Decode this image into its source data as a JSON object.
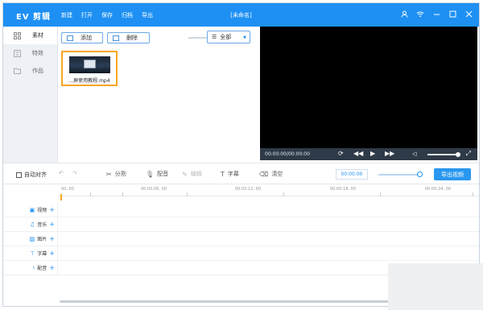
{
  "titlebar": {
    "logo": "EV 剪辑",
    "menu": [
      "新建",
      "打开",
      "保存",
      "归档",
      "导出"
    ],
    "doc_title": "[未命名]"
  },
  "leftnav": {
    "items": [
      {
        "label": "素材",
        "icon": "grid-icon",
        "active": true
      },
      {
        "label": "特效",
        "icon": "effects-icon",
        "active": false
      },
      {
        "label": "作品",
        "icon": "folder-icon",
        "active": false
      }
    ]
  },
  "media": {
    "add_label": "添加",
    "delete_label": "删除",
    "filter_value": "全部",
    "file_name": "...屏使用教程.mp4"
  },
  "preview": {
    "timecode": "00:00:00/00:00:00"
  },
  "toolbar": {
    "auto_align": "自动对齐",
    "split": "分割",
    "dub": "配音",
    "edit": "编辑",
    "subtitle": "字幕",
    "clear": "清空",
    "position": "00:00:00",
    "export": "导出视频"
  },
  "timeline": {
    "ticks": [
      "00, 00",
      "00:00:06, 00",
      "00:00:12, 00",
      "00:00:18, 00",
      "00:00:24, 00"
    ],
    "tracks": [
      {
        "label": "视频",
        "icon": "video-icon"
      },
      {
        "label": "音乐",
        "icon": "music-icon"
      },
      {
        "label": "图片",
        "icon": "image-icon"
      },
      {
        "label": "字幕",
        "icon": "text-icon"
      },
      {
        "label": "配音",
        "icon": "mic-icon"
      }
    ]
  },
  "colors": {
    "accent": "#1e90f3",
    "selection": "#f5a623"
  }
}
